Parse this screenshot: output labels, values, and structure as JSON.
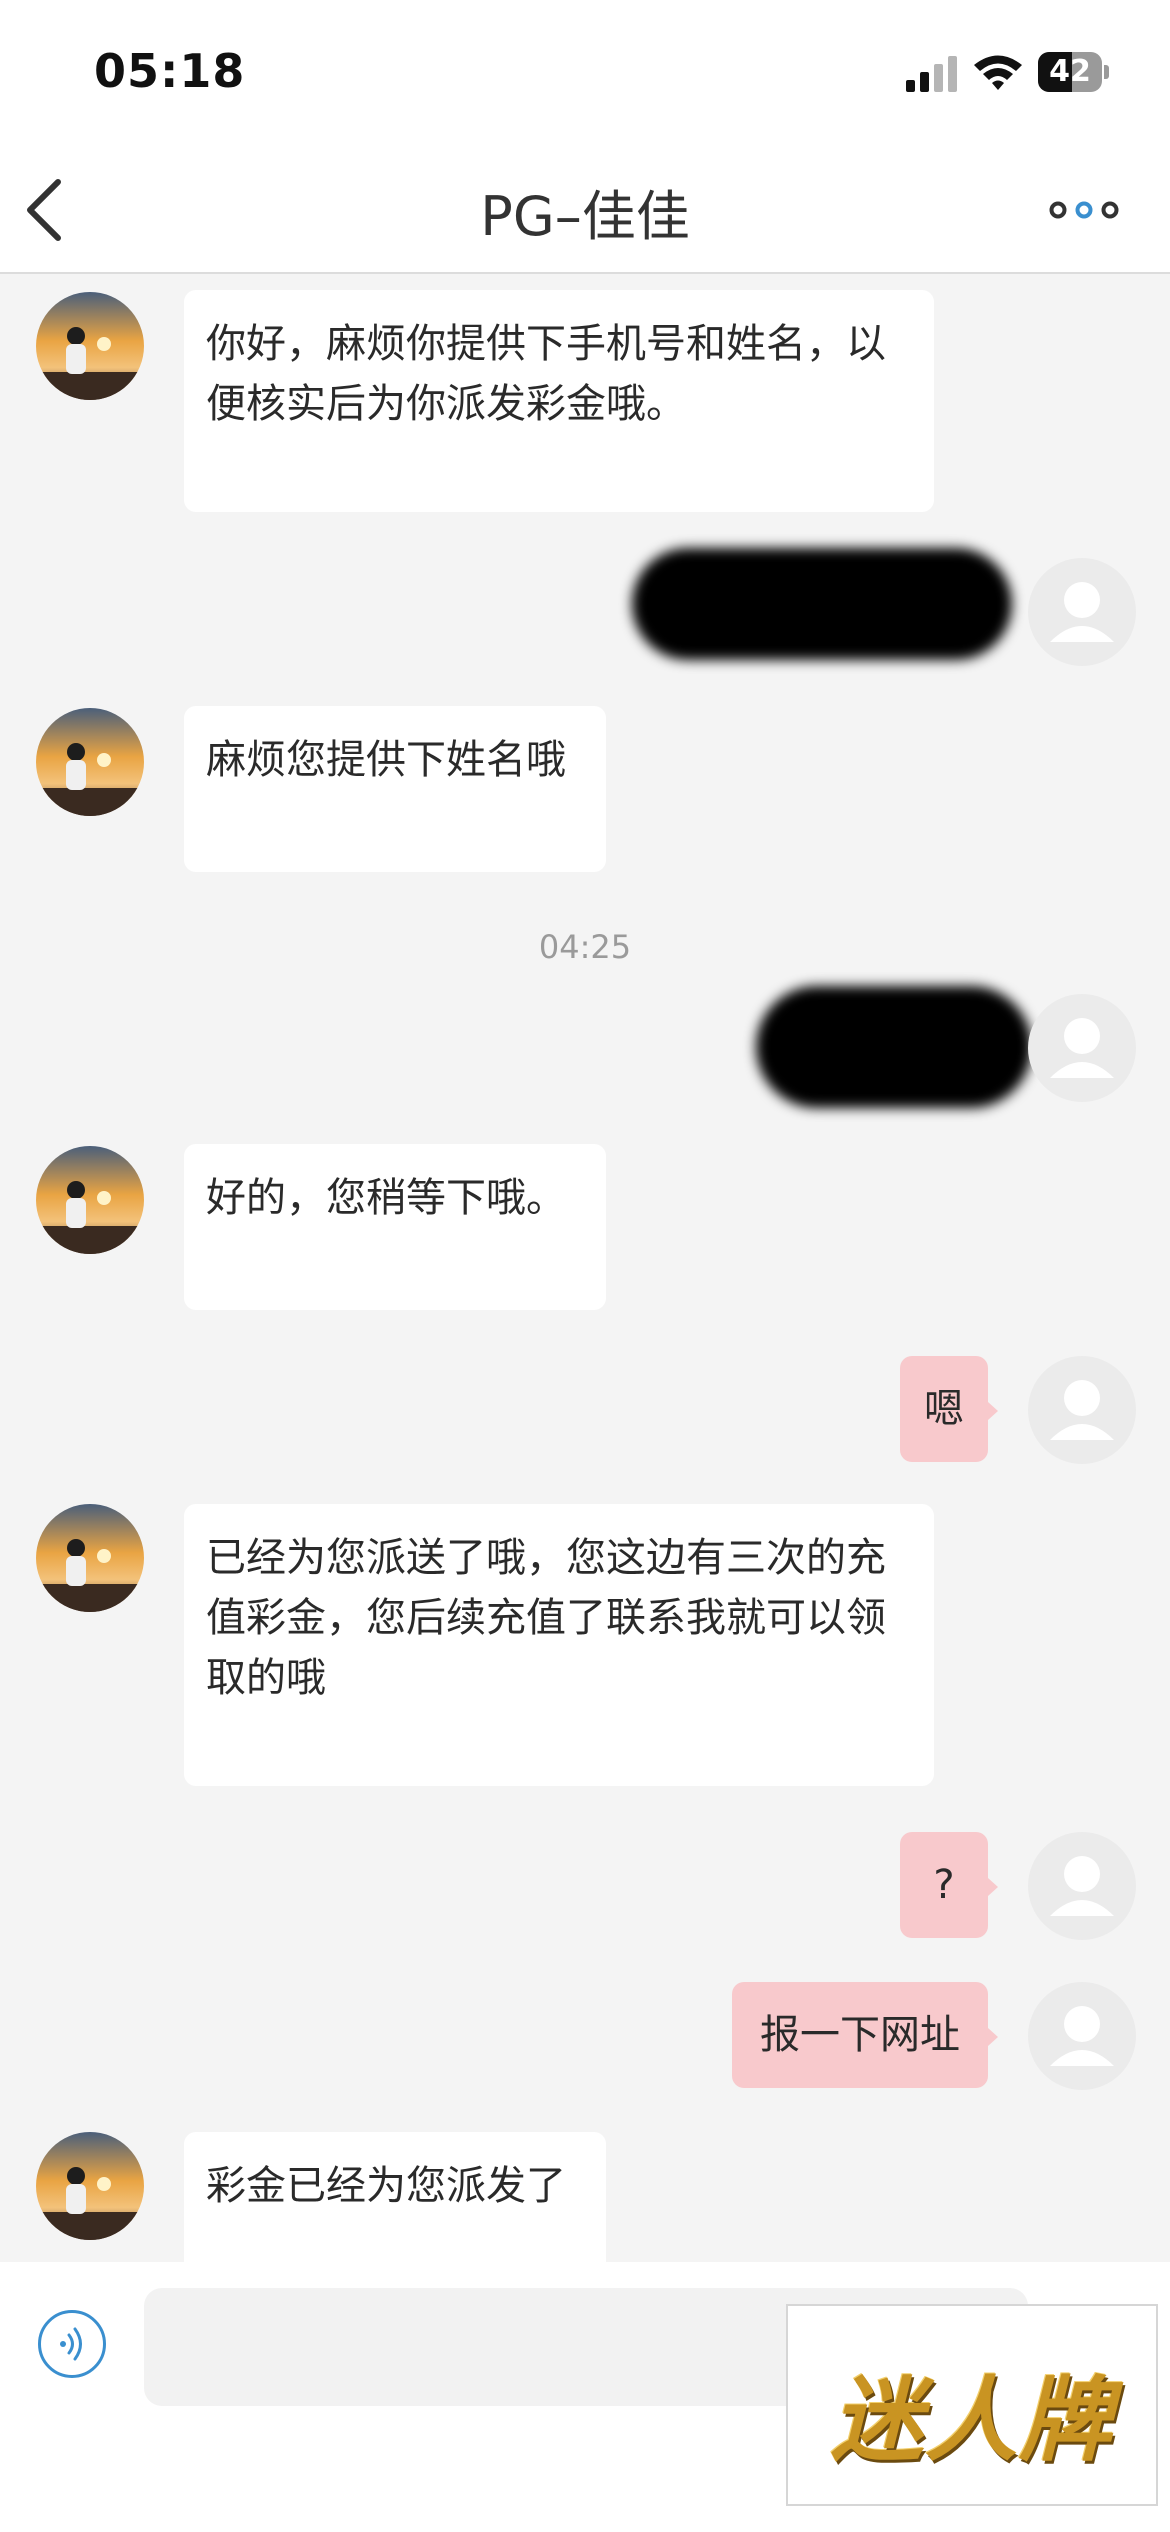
{
  "status_bar": {
    "time": "05:18",
    "battery": "42"
  },
  "header": {
    "title": "PG–佳佳"
  },
  "messages": [
    {
      "side": "in",
      "text": "你好，麻烦你提供下手机号和姓名，以便核实后为你派发彩金哦。"
    },
    {
      "side": "out",
      "text": "",
      "redacted": true
    },
    {
      "side": "in",
      "text": "麻烦您提供下姓名哦"
    },
    {
      "type": "time",
      "text": "04:25"
    },
    {
      "side": "out",
      "text": "",
      "redacted": true
    },
    {
      "side": "in",
      "text": "好的，您稍等下哦。"
    },
    {
      "side": "out",
      "text": "嗯"
    },
    {
      "side": "in",
      "text": "已经为您派送了哦，您这边有三次的充值彩金，您后续充值了联系我就可以领取的哦"
    },
    {
      "side": "out",
      "text": "?"
    },
    {
      "side": "out",
      "text": "报一下网址"
    },
    {
      "side": "in",
      "text": "彩金已经为您派发了"
    }
  ],
  "input": {
    "placeholder": ""
  },
  "watermark": {
    "text": "迷人牌"
  },
  "colors": {
    "outgoing_bubble": "#f8c9cc",
    "incoming_bubble": "#ffffff",
    "background": "#f4f4f4",
    "accent": "#3a8fcf"
  },
  "icons": [
    "back-chevron-icon",
    "more-dots-icon",
    "voice-icon",
    "signal-icon",
    "wifi-icon",
    "battery-icon"
  ]
}
